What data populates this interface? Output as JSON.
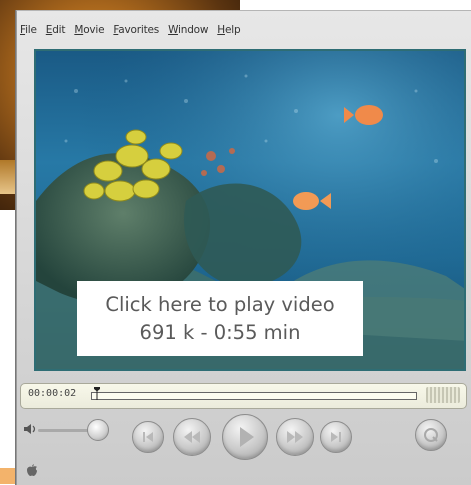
{
  "menu": {
    "file": "File",
    "edit": "Edit",
    "movie": "Movie",
    "favorites": "Favorites",
    "window": "Window",
    "help": "Help"
  },
  "video": {
    "overlay_line1": "Click here to play video",
    "overlay_line2": "691 k -  0:55 min"
  },
  "timeline": {
    "timecode": "00:00:02",
    "position_fraction": 0.01
  },
  "controls": {
    "volume_icon": "speaker-icon",
    "buttons": [
      "back-to-start-icon",
      "rewind-icon",
      "play-icon",
      "fast-forward-icon",
      "go-to-end-icon",
      "quicktime-logo-icon"
    ]
  },
  "colors": {
    "player_chrome": "#d6d6d6",
    "video_border": "#2e6d74",
    "overlay_text": "#5a5a5a"
  }
}
